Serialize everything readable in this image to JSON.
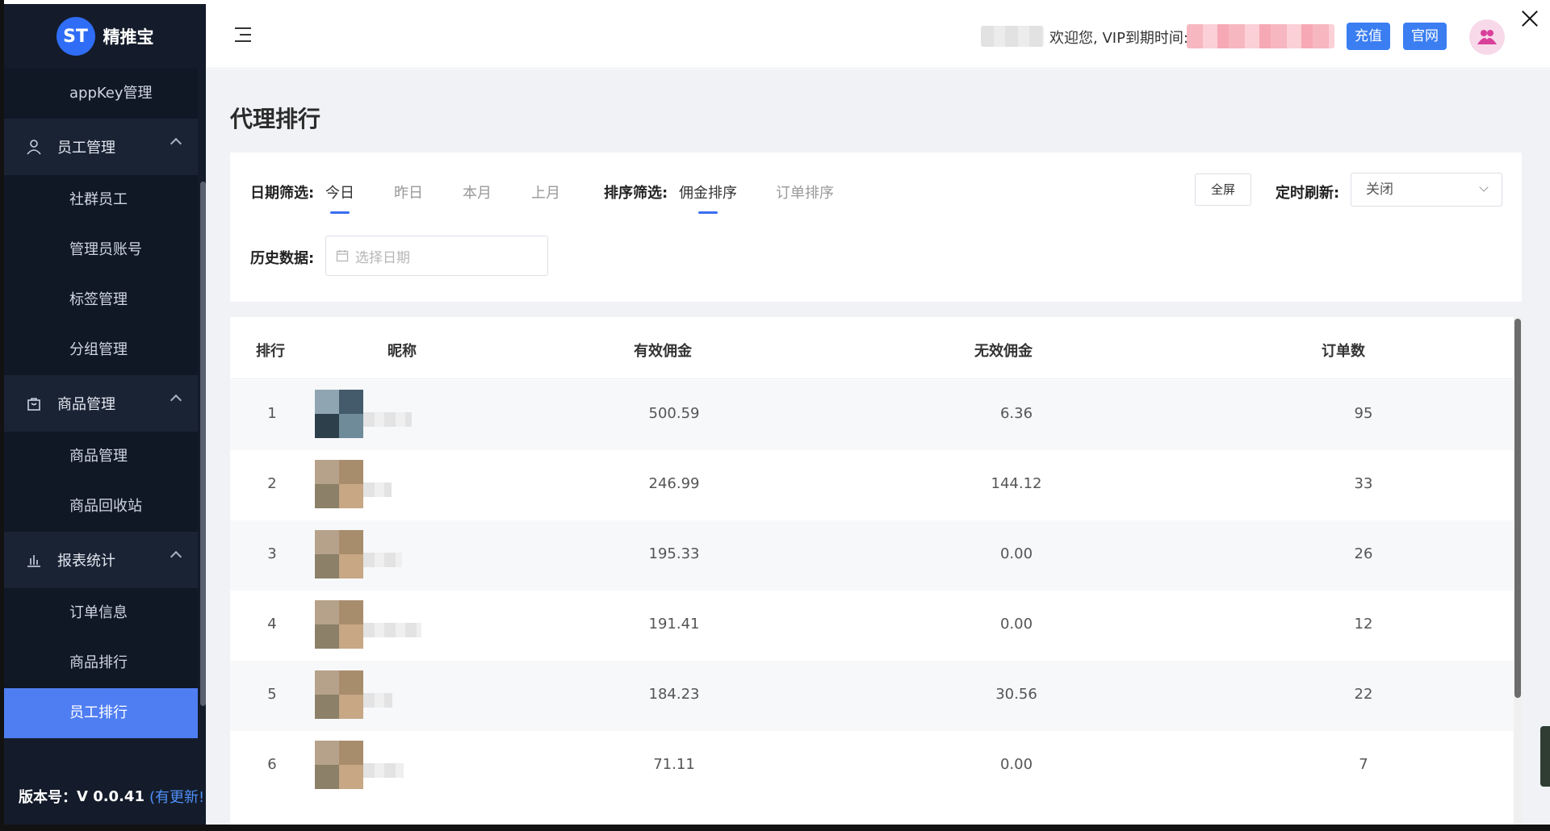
{
  "app": {
    "logo_text": "精推宝",
    "logo_glyph": "ST"
  },
  "sidebar": {
    "items": [
      {
        "type": "sub",
        "label": "appKey管理"
      },
      {
        "type": "group",
        "label": "员工管理",
        "icon": "user-icon"
      },
      {
        "type": "sub",
        "label": "社群员工"
      },
      {
        "type": "sub",
        "label": "管理员账号"
      },
      {
        "type": "sub",
        "label": "标签管理"
      },
      {
        "type": "sub",
        "label": "分组管理"
      },
      {
        "type": "group",
        "label": "商品管理",
        "icon": "shopping-bag-icon"
      },
      {
        "type": "sub",
        "label": "商品管理"
      },
      {
        "type": "sub",
        "label": "商品回收站"
      },
      {
        "type": "group",
        "label": "报表统计",
        "icon": "bar-chart-icon"
      },
      {
        "type": "sub",
        "label": "订单信息"
      },
      {
        "type": "sub",
        "label": "商品排行"
      },
      {
        "type": "sub",
        "label": "员工排行",
        "active": true
      }
    ],
    "version_label": "版本号：",
    "version_value": "V 0.0.41",
    "update_text": "(有更新!)"
  },
  "header": {
    "welcome_text": "欢迎您, VIP到期时间:",
    "recharge_label": "充值",
    "official_label": "官网"
  },
  "page": {
    "title": "代理排行"
  },
  "filters": {
    "date_label": "日期筛选:",
    "date_options": [
      "今日",
      "昨日",
      "本月",
      "上月"
    ],
    "date_active": "今日",
    "sort_label": "排序筛选:",
    "sort_options": [
      "佣金排序",
      "订单排序"
    ],
    "sort_active": "佣金排序",
    "fullscreen_label": "全屏",
    "refresh_label": "定时刷新:",
    "refresh_value": "关闭",
    "history_label": "历史数据:",
    "history_placeholder": "选择日期"
  },
  "table": {
    "columns": [
      "排行",
      "昵称",
      "有效佣金",
      "无效佣金",
      "订单数"
    ],
    "rows": [
      {
        "rank": "1",
        "valid": "500.59",
        "invalid": "6.36",
        "orders": "95"
      },
      {
        "rank": "2",
        "valid": "246.99",
        "invalid": "144.12",
        "orders": "33"
      },
      {
        "rank": "3",
        "valid": "195.33",
        "invalid": "0.00",
        "orders": "26"
      },
      {
        "rank": "4",
        "valid": "191.41",
        "invalid": "0.00",
        "orders": "12"
      },
      {
        "rank": "5",
        "valid": "184.23",
        "invalid": "30.56",
        "orders": "22"
      },
      {
        "rank": "6",
        "valid": "71.11",
        "invalid": "0.00",
        "orders": "7"
      }
    ]
  },
  "colors": {
    "sidebar_bg": "#141c2b",
    "accent": "#4f7df2",
    "button_blue": "#3a7ef2"
  }
}
